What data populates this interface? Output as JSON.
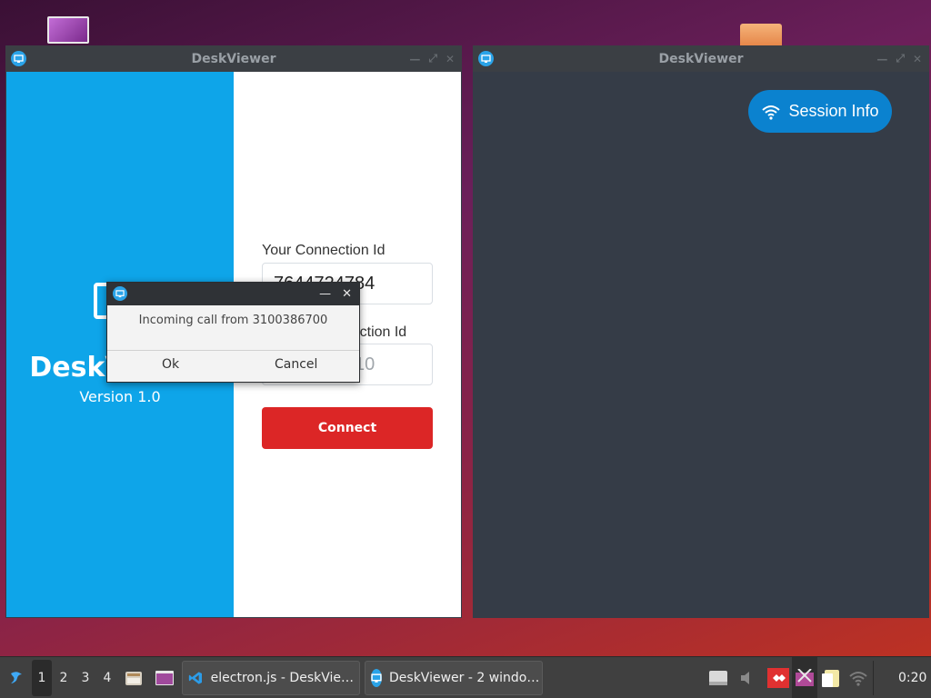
{
  "desktop": {
    "icons": [
      "image-file-icon",
      "folder-icon"
    ]
  },
  "left_window": {
    "title": "DeskViewer",
    "brand": {
      "name": "DeskViewer",
      "version": "Version 1.0"
    },
    "form": {
      "your_id_label": "Your Connection Id",
      "your_id_value": "7644724784",
      "remote_id_label": "Remote Connection Id",
      "remote_id_placeholder": "1234567810",
      "connect_label": "Connect"
    }
  },
  "right_window": {
    "title": "DeskViewer",
    "session_info_label": "Session Info"
  },
  "dialog": {
    "message": "Incoming call from 3100386700",
    "ok_label": "Ok",
    "cancel_label": "Cancel"
  },
  "taskbar": {
    "workspaces": [
      "1",
      "2",
      "3",
      "4"
    ],
    "active_workspace": "1",
    "tasks": [
      {
        "label": "electron.js - DeskVie…",
        "icon": "vscode-icon"
      },
      {
        "label": "DeskViewer - 2 windo…",
        "icon": "deskviewer-icon"
      }
    ],
    "clock": "0:20"
  },
  "colors": {
    "brand_blue": "#0ea5e9",
    "connect_red": "#dc2626",
    "session_blue": "#0b82cf",
    "remote_bg": "#353c47"
  }
}
